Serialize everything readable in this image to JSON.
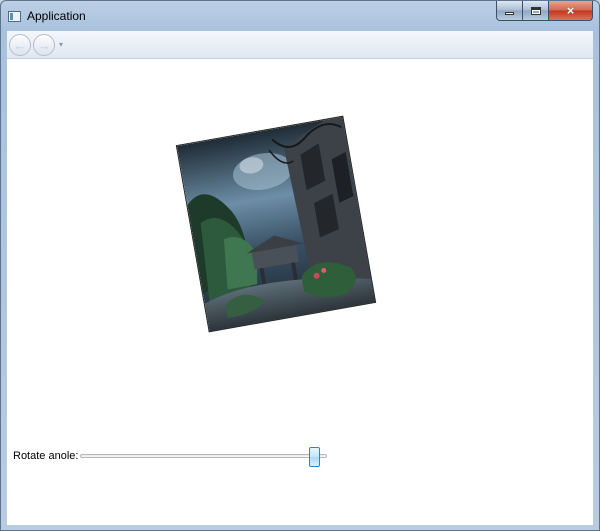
{
  "window": {
    "title": "Application",
    "close_glyph": "×"
  },
  "nav": {
    "back_icon": "arrow-left-icon",
    "forward_icon": "arrow-right-icon",
    "dropdown_glyph": "▾"
  },
  "content": {
    "image_icon": "rotated-photo",
    "rotate_label": "Rotate anole:",
    "slider_value": 0.97
  }
}
